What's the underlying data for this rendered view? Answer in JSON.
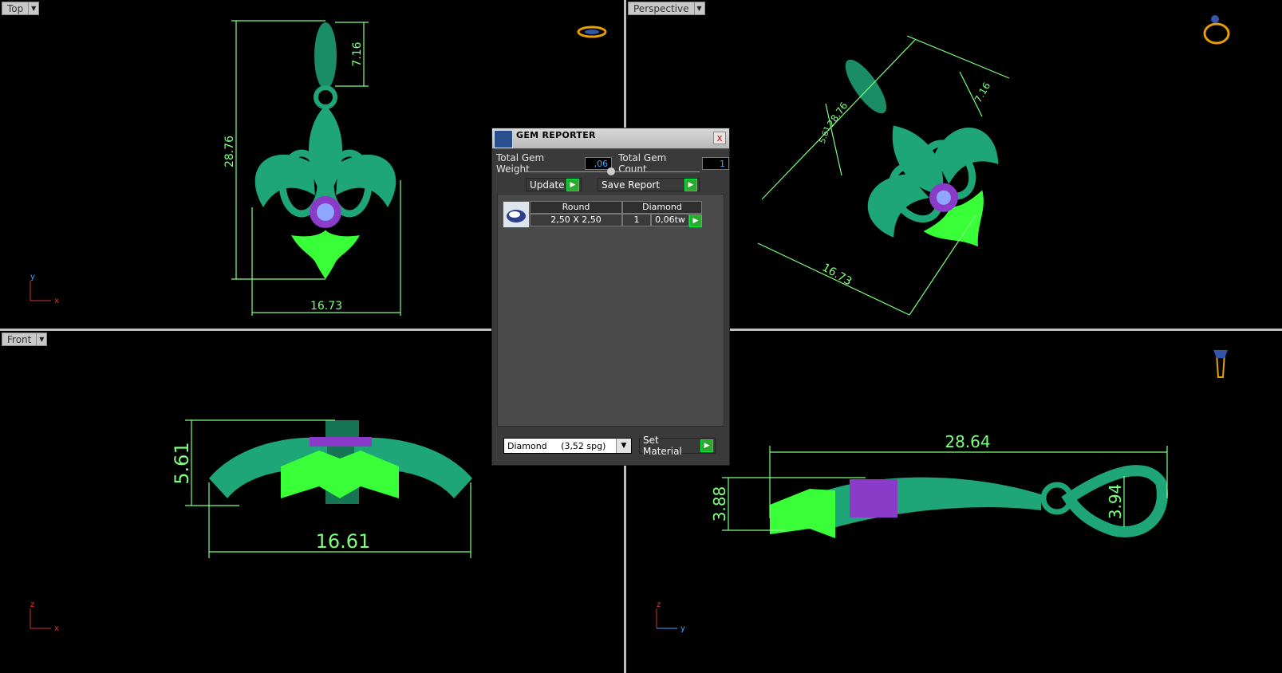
{
  "viewports": {
    "top": {
      "label": "Top",
      "axis_a": "y",
      "axis_b": "x",
      "dim_height": "28.76",
      "dim_bail": "7.16",
      "dim_width": "16.73"
    },
    "perspective": {
      "label": "Perspective",
      "dim_height": "28.76",
      "dim_bail": "7.16",
      "dim_width": "16.73",
      "dim_extra": "5.61"
    },
    "front": {
      "label": "Front",
      "axis_a": "z",
      "axis_b": "x",
      "dim_height": "5.61",
      "dim_width": "16.61"
    },
    "side": {
      "axis_a": "z",
      "axis_b": "y",
      "dim_length": "28.64",
      "dim_height": "3.88",
      "dim_bail": "3.94"
    }
  },
  "gem_reporter": {
    "title": "GEM REPORTER",
    "close": "x",
    "total_weight_label": "Total Gem Weight",
    "total_weight_value": ",06",
    "total_count_label": "Total Gem Count",
    "total_count_value": "1",
    "update_label": "Update",
    "save_label": "Save Report",
    "table": {
      "headers": [
        "Round",
        "Diamond"
      ],
      "row": {
        "size": "2,50 X 2,50",
        "count": "1",
        "weight": "0,06tw"
      }
    },
    "material_select": "Diamond     (3,52 spg)",
    "set_material_label": "Set Material"
  },
  "colors": {
    "mesh": "#1fa678",
    "highlight": "#39ff39",
    "gem": "#8a3cc8",
    "dimension": "#7fff7f"
  }
}
